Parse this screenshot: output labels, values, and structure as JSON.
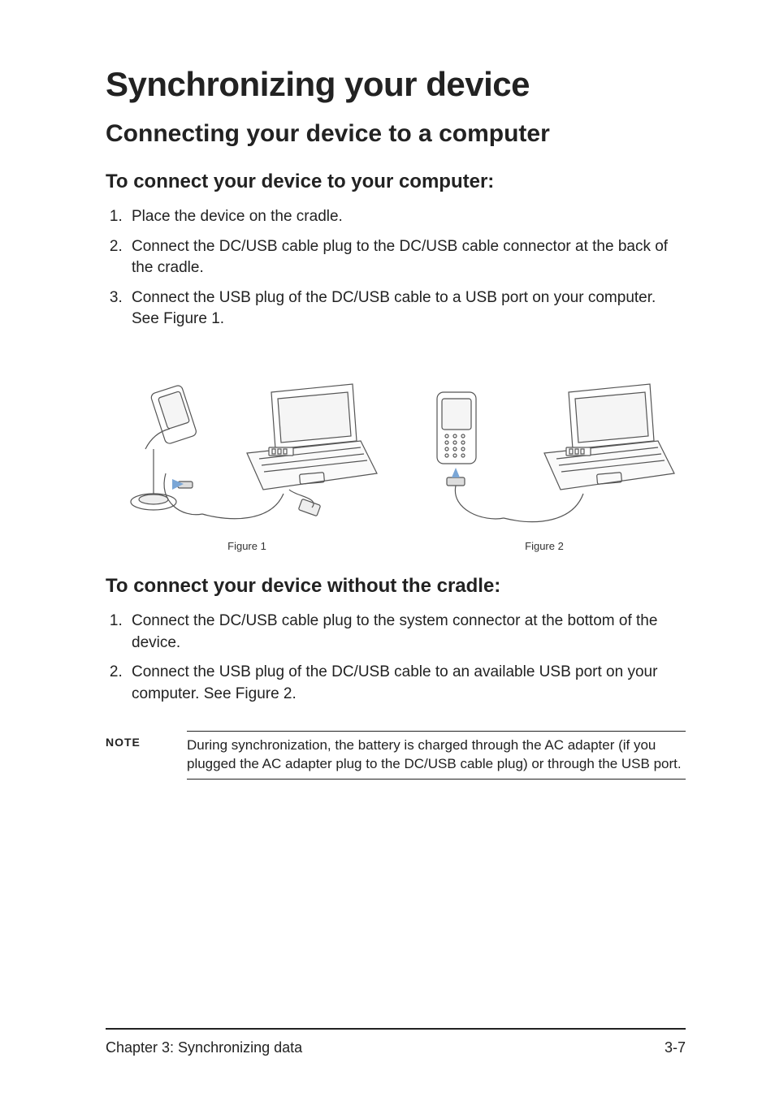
{
  "title": "Synchronizing your device",
  "section1": {
    "heading": "Connecting your device to a computer",
    "sub1": {
      "heading": "To connect your device to your computer:",
      "steps": [
        "Place the device on the cradle.",
        "Connect the DC/USB cable plug to the DC/USB cable connector at the back of the cradle.",
        "Connect the USB plug of the DC/USB cable to a USB port on your computer. See Figure 1."
      ]
    },
    "figures": {
      "fig1_caption": "Figure 1",
      "fig2_caption": "Figure 2"
    },
    "sub2": {
      "heading": "To connect your device without the cradle:",
      "steps": [
        "Connect the DC/USB cable plug to the system connector at the bottom of the device.",
        "Connect the USB plug of the DC/USB cable to an available USB port on your computer. See Figure 2."
      ]
    },
    "note": {
      "label": "NOTE",
      "text": "During synchronization, the battery is charged through the AC adapter (if you plugged the AC adapter plug to the DC/USB cable plug) or through the USB port."
    }
  },
  "footer": {
    "chapter": "Chapter 3: Synchronizing data",
    "page": "3-7"
  }
}
